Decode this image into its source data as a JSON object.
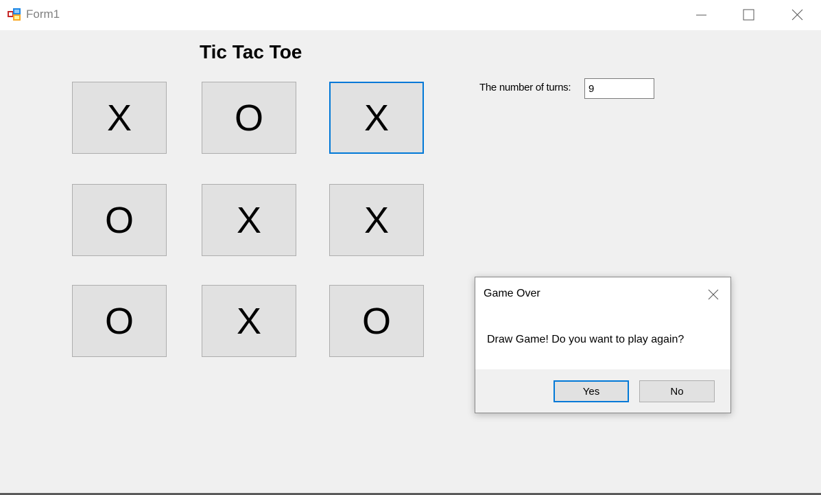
{
  "window": {
    "title": "Form1",
    "controls": {
      "minimize_icon": "minimize-icon",
      "maximize_icon": "maximize-icon",
      "close_icon": "close-icon"
    }
  },
  "game": {
    "title": "Tic Tac Toe",
    "board": [
      [
        "X",
        "O",
        "X"
      ],
      [
        "O",
        "X",
        "X"
      ],
      [
        "O",
        "X",
        "O"
      ]
    ],
    "focused_cell": [
      0,
      2
    ],
    "turns_label": "The number of turns:",
    "turns_value": "9"
  },
  "dialog": {
    "title": "Game Over",
    "message": "Draw Game! Do you want to play again?",
    "yes_label": "Yes",
    "no_label": "No"
  },
  "colors": {
    "accent": "#0078d7",
    "button_face": "#e1e1e1",
    "form_background": "#f0f0f0"
  }
}
